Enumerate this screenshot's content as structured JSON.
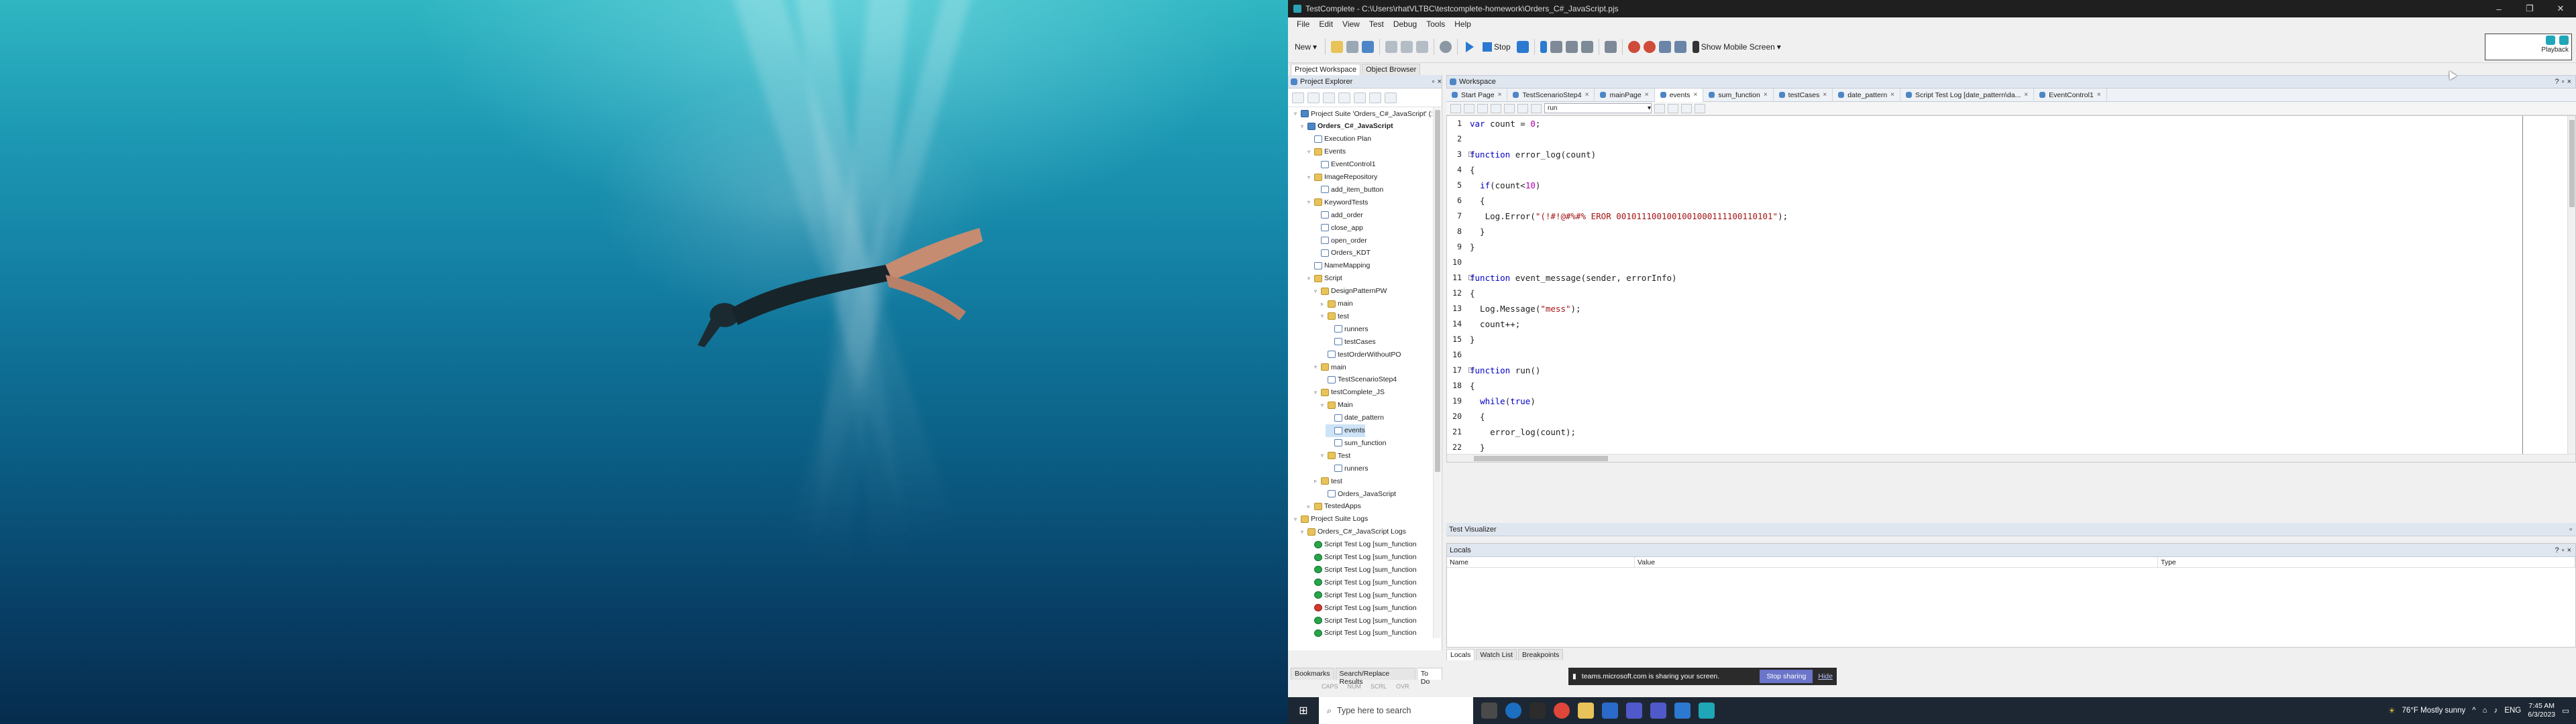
{
  "window": {
    "title": "TestComplete - C:\\Users\\rhatVLTBC\\testcomplete-homework\\Orders_C#_JavaScript.pjs",
    "controls": [
      "–",
      "❐",
      "✕"
    ]
  },
  "menu": [
    "File",
    "Edit",
    "View",
    "Test",
    "Debug",
    "Tools",
    "Help"
  ],
  "toolbar": {
    "new_label": "New",
    "stop_label": "Stop",
    "mobile_label": "Show Mobile Screen"
  },
  "help_box": {
    "playback": "Playback",
    "project_name": "Orders_C#_JavaScript"
  },
  "explorer_tabs": [
    "Project Workspace",
    "Object Browser"
  ],
  "project_explorer": {
    "title": "Project Explorer",
    "tree": [
      {
        "label": "Project Suite 'Orders_C#_JavaScript' (1 project)",
        "icon": "suite",
        "depth": 0,
        "open": true
      },
      {
        "label": "Orders_C#_JavaScript",
        "icon": "suite",
        "depth": 1,
        "open": true,
        "bold": true
      },
      {
        "label": "Execution Plan",
        "icon": "file",
        "depth": 2
      },
      {
        "label": "Events",
        "icon": "folder",
        "depth": 2,
        "open": true
      },
      {
        "label": "EventControl1",
        "icon": "file",
        "depth": 3
      },
      {
        "label": "ImageRepository",
        "icon": "folder",
        "depth": 2,
        "open": true
      },
      {
        "label": "add_item_button",
        "icon": "file",
        "depth": 3
      },
      {
        "label": "KeywordTests",
        "icon": "folder",
        "depth": 2,
        "open": true,
        "add": true
      },
      {
        "label": "add_order",
        "icon": "file",
        "depth": 3
      },
      {
        "label": "close_app",
        "icon": "file",
        "depth": 3
      },
      {
        "label": "open_order",
        "icon": "file",
        "depth": 3
      },
      {
        "label": "Orders_KDT",
        "icon": "file",
        "depth": 3
      },
      {
        "label": "NameMapping",
        "icon": "file",
        "depth": 2
      },
      {
        "label": "Script",
        "icon": "folder",
        "depth": 2,
        "open": true,
        "add": true
      },
      {
        "label": "DesignPatternPW",
        "icon": "folder",
        "depth": 3,
        "open": true
      },
      {
        "label": "main",
        "icon": "folder",
        "depth": 4
      },
      {
        "label": "test",
        "icon": "folder",
        "depth": 4,
        "open": true
      },
      {
        "label": "runners",
        "icon": "file",
        "depth": 5
      },
      {
        "label": "testCases",
        "icon": "file",
        "depth": 5
      },
      {
        "label": "testOrderWithoutPO",
        "icon": "file",
        "depth": 4
      },
      {
        "label": "main",
        "icon": "folder",
        "depth": 3,
        "open": true
      },
      {
        "label": "TestScenarioStep4",
        "icon": "file",
        "depth": 4
      },
      {
        "label": "testComplete_JS",
        "icon": "folder",
        "depth": 3,
        "open": true
      },
      {
        "label": "Main",
        "icon": "folder",
        "depth": 4,
        "open": true
      },
      {
        "label": "date_pattern",
        "icon": "file",
        "depth": 5
      },
      {
        "label": "events",
        "icon": "file",
        "depth": 5,
        "selected": true
      },
      {
        "label": "sum_function",
        "icon": "file",
        "depth": 5
      },
      {
        "label": "Test",
        "icon": "folder",
        "depth": 4,
        "open": true
      },
      {
        "label": "runners",
        "icon": "file",
        "depth": 5
      },
      {
        "label": "test",
        "icon": "folder",
        "depth": 3
      },
      {
        "label": "Orders_JavaScript",
        "icon": "file",
        "depth": 4
      },
      {
        "label": "TestedApps",
        "icon": "folder",
        "depth": 2
      },
      {
        "label": "Project Suite Logs",
        "icon": "folder",
        "depth": 0,
        "open": true
      },
      {
        "label": "Orders_C#_JavaScript Logs",
        "icon": "folder",
        "depth": 1,
        "open": true
      },
      {
        "label": "Script Test Log [sum_function",
        "icon": "log",
        "depth": 2
      },
      {
        "label": "Script Test Log [sum_function",
        "icon": "log",
        "depth": 2
      },
      {
        "label": "Script Test Log [sum_function",
        "icon": "log",
        "depth": 2
      },
      {
        "label": "Script Test Log [sum_function",
        "icon": "log",
        "depth": 2
      },
      {
        "label": "Script Test Log [sum_function",
        "icon": "log",
        "depth": 2
      },
      {
        "label": "Script Test Log [sum_function",
        "icon": "logerr",
        "depth": 2
      },
      {
        "label": "Script Test Log [sum_function",
        "icon": "log",
        "depth": 2
      },
      {
        "label": "Script Test Log [sum_function",
        "icon": "log",
        "depth": 2
      }
    ]
  },
  "bottom_left_tabs": [
    "Bookmarks",
    "Search/Replace Results",
    "To Do"
  ],
  "status": [
    "CAPS",
    "NUM",
    "SCRL",
    "OVR"
  ],
  "workspace": {
    "title": "Workspace",
    "tabs": [
      {
        "label": "Start Page"
      },
      {
        "label": "TestScenarioStep4"
      },
      {
        "label": "mainPage"
      },
      {
        "label": "events",
        "active": true
      },
      {
        "label": "sum_function"
      },
      {
        "label": "testCases"
      },
      {
        "label": "date_pattern"
      },
      {
        "label": "Script Test Log [date_pattern\\da..."
      },
      {
        "label": "EventControl1"
      }
    ],
    "routine": "run"
  },
  "code_lines": [
    "var count = 0;",
    "",
    "function error_log(count)",
    "{",
    "  if(count<10)",
    "  {",
    "   Log.Error(\"(!#!@#%#% EROR 0010111001001001000111100110101\");",
    "  }",
    "}",
    "",
    "function event_message(sender, errorInfo)",
    "{",
    "  Log.Message(\"mess\");",
    "  count++;",
    "}",
    "",
    "function run()",
    "{",
    "  while(true)",
    "  {",
    "    error_log(count);",
    "  }",
    "}"
  ],
  "test_visualizer": {
    "title": "Test Visualizer"
  },
  "locals": {
    "title": "Locals",
    "columns": [
      "Name",
      "Value",
      "Type"
    ],
    "tabs": [
      "Locals",
      "Watch List",
      "Breakpoints"
    ]
  },
  "notification": {
    "text": "teams.microsoft.com is sharing your screen.",
    "stop": "Stop sharing",
    "hide": "Hide"
  },
  "taskbar": {
    "search_placeholder": "Type here to search",
    "weather": "76°F  Mostly sunny",
    "lang": "ENG",
    "time": "7:45 AM",
    "date": "6/3/2023"
  }
}
